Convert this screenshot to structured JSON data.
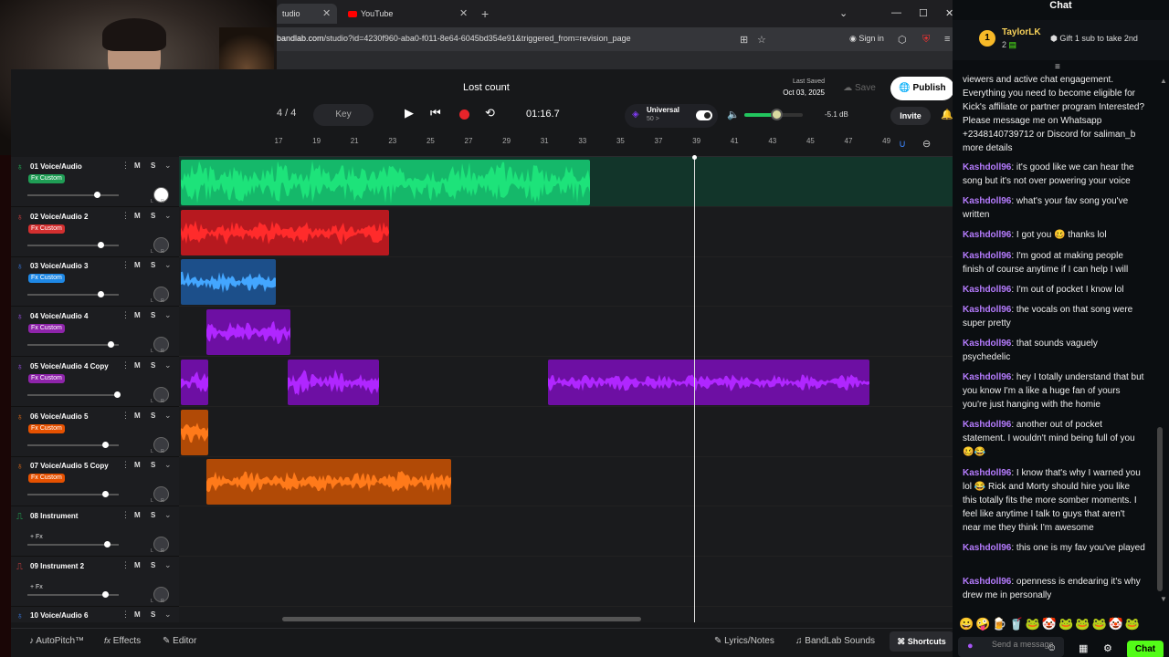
{
  "browser": {
    "tabs": [
      {
        "title": "tudio"
      },
      {
        "title": "YouTube"
      }
    ],
    "url_host": "bandlab.com",
    "url_path": "/studio?id=4230f960-aba0-f011-8e64-6045bd354e91&triggered_from=revision_page",
    "sign_in": "Sign in"
  },
  "daw": {
    "project_name": "Lost count",
    "bars": "4  /  4",
    "key_label": "Key",
    "time": "01:16.7",
    "universal_title": "Universal",
    "universal_sub": "50 >",
    "db": "-5.1 dB",
    "volume_level": 0.55,
    "last_saved_label": "Last Saved",
    "last_saved_date": "Oct 03, 2025",
    "save_label": "Save",
    "publish_label": "Publish",
    "invite_label": "Invite",
    "ruler": [
      "17",
      "19",
      "21",
      "23",
      "25",
      "27",
      "29",
      "31",
      "33",
      "35",
      "37",
      "39",
      "41",
      "43",
      "45",
      "47",
      "49"
    ],
    "tracks": [
      {
        "name": "01 Voice/Audio",
        "fx": "Fx Custom",
        "fx_color": "#1f9d55",
        "icon_color": "#22c55e",
        "vol": 0.83,
        "pan_white": true
      },
      {
        "name": "02 Voice/Audio 2",
        "fx": "Fx Custom",
        "fx_color": "#d32f2f",
        "icon_color": "#ef4444",
        "vol": 0.88
      },
      {
        "name": "03 Voice/Audio 3",
        "fx": "Fx Custom",
        "fx_color": "#1e88e5",
        "icon_color": "#3b82f6",
        "vol": 0.88
      },
      {
        "name": "04 Voice/Audio 4",
        "fx": "Fx Custom",
        "fx_color": "#8e24aa",
        "icon_color": "#a855f7",
        "vol": 1.0
      },
      {
        "name": "05 Voice/Audio 4 Copy",
        "fx": "Fx Custom",
        "fx_color": "#8e24aa",
        "icon_color": "#a855f7",
        "vol": 1.08
      },
      {
        "name": "06 Voice/Audio 5",
        "fx": "Fx Custom",
        "fx_color": "#e65100",
        "icon_color": "#f97316",
        "vol": 0.93
      },
      {
        "name": "07 Voice/Audio 5 Copy",
        "fx": "Fx Custom",
        "fx_color": "#e65100",
        "icon_color": "#f97316",
        "vol": 0.93
      },
      {
        "name": "08 Instrument",
        "fx": "+ Fx",
        "fx_color": "",
        "icon_color": "#22c55e",
        "vol": 0.95
      },
      {
        "name": "09 Instrument 2",
        "fx": "+ Fx",
        "fx_color": "",
        "icon_color": "#ef4444",
        "vol": 0.93
      },
      {
        "name": "10 Voice/Audio 6",
        "fx": "",
        "fx_color": "",
        "icon_color": "#3b82f6",
        "vol": 0.9
      }
    ],
    "footer": {
      "autopitch": "AutoPitch™",
      "effects": "Effects",
      "editor": "Editor",
      "lyrics": "Lyrics/Notes",
      "sounds": "BandLab Sounds",
      "shortcuts": "Shortcuts"
    }
  },
  "chat": {
    "title": "Chat",
    "gifter": "TaylorLK",
    "gift_count": "2",
    "gift_rank": "1",
    "gift_cta": "Gift 1 sub to take 2nd",
    "messages": [
      {
        "user": "",
        "text": "viewers and active chat engagement. Everything you need to become eligible for Kick's affiliate or partner program Interested? Please message me on Whatsapp +2348140739712 or Discord for saliman_b more details"
      },
      {
        "user": "Kashdoll96",
        "text": "it's good like we can hear the song but it's not over powering your voice"
      },
      {
        "user": "Kashdoll96",
        "text": "what's your fav song you've written"
      },
      {
        "user": "Kashdoll96",
        "text": "I got you 🥴 thanks lol"
      },
      {
        "user": "Kashdoll96",
        "text": "I'm good at making people finish of course anytime if I can help I will"
      },
      {
        "user": "Kashdoll96",
        "text": "I'm out of pocket I know lol"
      },
      {
        "user": "Kashdoll96",
        "text": "the vocals on that song were super pretty"
      },
      {
        "user": "Kashdoll96",
        "text": "that sounds vaguely psychedelic"
      },
      {
        "user": "Kashdoll96",
        "text": "hey I totally understand that but you know I'm a like a huge fan of yours you're just hanging with the homie"
      },
      {
        "user": "Kashdoll96",
        "text": "another out of pocket statement. I wouldn't mind being full of you 🥴😂"
      },
      {
        "user": "Kashdoll96",
        "text": "I know that's why I warned you lol 😂 Rick and Morty should hire you like this totally fits the more somber moments. I feel like anytime I talk to guys that aren't near me they think I'm awesome"
      },
      {
        "user": "Kashdoll96",
        "text": "this one is my fav you've played"
      },
      {
        "user": "Kashdoll96",
        "text": "openness is endearing it's why drew me in personally"
      }
    ],
    "input_placeholder": "Send a message",
    "chat_button": "Chat"
  }
}
